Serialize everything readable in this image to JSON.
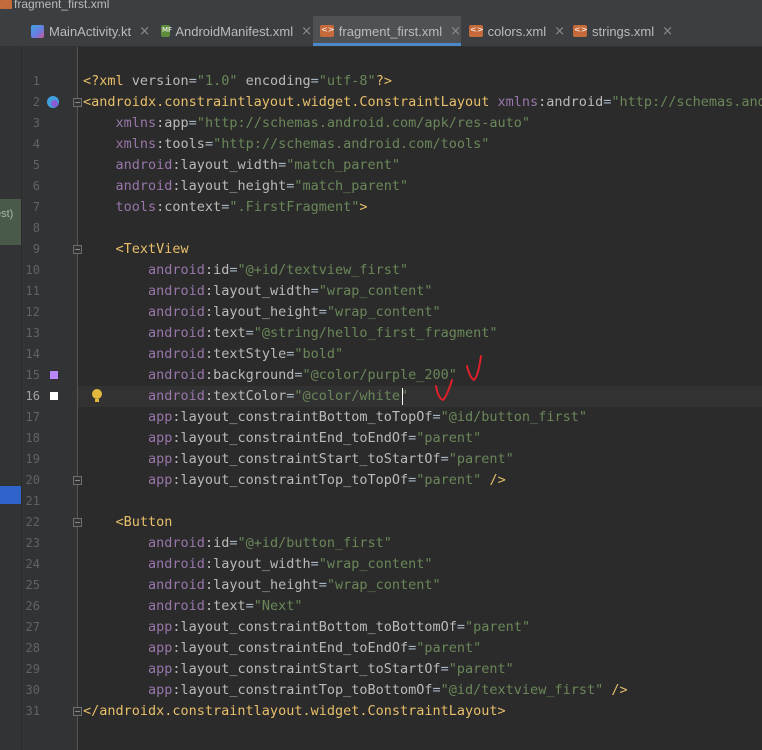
{
  "window": {
    "title": "fragment_first.xml"
  },
  "tabs": [
    {
      "label": "MainActivity.kt",
      "icon": "kotlin-file-icon",
      "active": false
    },
    {
      "label": "AndroidManifest.xml",
      "icon": "manifest-file-icon",
      "active": false
    },
    {
      "label": "fragment_first.xml",
      "icon": "xml-file-icon",
      "active": true
    },
    {
      "label": "colors.xml",
      "icon": "xml-file-icon",
      "active": false
    },
    {
      "label": "strings.xml",
      "icon": "xml-file-icon",
      "active": false
    }
  ],
  "side_panel": {
    "partial_text": "est)"
  },
  "editor": {
    "current_line": 16,
    "colors": {
      "purple_200": "#bb86fc",
      "white": "#ffffff"
    },
    "lines": [
      {
        "n": "1",
        "text": "<?xml version=\"1.0\" encoding=\"utf-8\"?>"
      },
      {
        "n": "2",
        "text": "<androidx.constraintlayout.widget.ConstraintLayout xmlns:android=\"http://schemas.andr"
      },
      {
        "n": "3",
        "text": "    xmlns:app=\"http://schemas.android.com/apk/res-auto\""
      },
      {
        "n": "4",
        "text": "    xmlns:tools=\"http://schemas.android.com/tools\""
      },
      {
        "n": "5",
        "text": "    android:layout_width=\"match_parent\""
      },
      {
        "n": "6",
        "text": "    android:layout_height=\"match_parent\""
      },
      {
        "n": "7",
        "text": "    tools:context=\".FirstFragment\">"
      },
      {
        "n": "8",
        "text": ""
      },
      {
        "n": "9",
        "text": "    <TextView"
      },
      {
        "n": "10",
        "text": "        android:id=\"@+id/textview_first\""
      },
      {
        "n": "11",
        "text": "        android:layout_width=\"wrap_content\""
      },
      {
        "n": "12",
        "text": "        android:layout_height=\"wrap_content\""
      },
      {
        "n": "13",
        "text": "        android:text=\"@string/hello_first_fragment\""
      },
      {
        "n": "14",
        "text": "        android:textStyle=\"bold\""
      },
      {
        "n": "15",
        "text": "        android:background=\"@color/purple_200\""
      },
      {
        "n": "16",
        "text": "        android:textColor=\"@color/white\""
      },
      {
        "n": "17",
        "text": "        app:layout_constraintBottom_toTopOf=\"@id/button_first\""
      },
      {
        "n": "18",
        "text": "        app:layout_constraintEnd_toEndOf=\"parent\""
      },
      {
        "n": "19",
        "text": "        app:layout_constraintStart_toStartOf=\"parent\""
      },
      {
        "n": "20",
        "text": "        app:layout_constraintTop_toTopOf=\"parent\" />"
      },
      {
        "n": "21",
        "text": ""
      },
      {
        "n": "22",
        "text": "    <Button"
      },
      {
        "n": "23",
        "text": "        android:id=\"@+id/button_first\""
      },
      {
        "n": "24",
        "text": "        android:layout_width=\"wrap_content\""
      },
      {
        "n": "25",
        "text": "        android:layout_height=\"wrap_content\""
      },
      {
        "n": "26",
        "text": "        android:text=\"Next\""
      },
      {
        "n": "27",
        "text": "        app:layout_constraintBottom_toBottomOf=\"parent\""
      },
      {
        "n": "28",
        "text": "        app:layout_constraintEnd_toEndOf=\"parent\""
      },
      {
        "n": "29",
        "text": "        app:layout_constraintStart_toStartOf=\"parent\""
      },
      {
        "n": "30",
        "text": "        app:layout_constraintTop_toBottomOf=\"@id/textview_first\" />"
      },
      {
        "n": "31",
        "text": "</androidx.constraintlayout.widget.ConstraintLayout>"
      }
    ]
  },
  "annotations": {
    "color": "#e0202a"
  }
}
